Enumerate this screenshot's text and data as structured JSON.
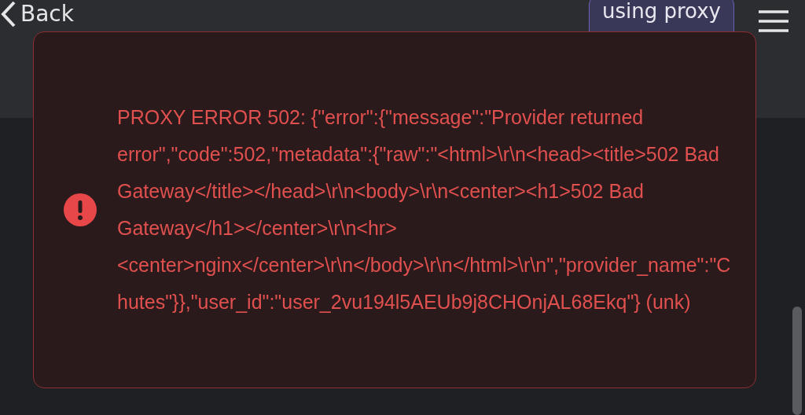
{
  "header": {
    "back_label": "Back",
    "proxy_button": "using proxy"
  },
  "error_toast": {
    "kind": "error",
    "message": "PROXY ERROR 502: {\"error\":{\"message\":\"Provider returned error\",\"code\":502,\"metadata\":{\"raw\":\"<html>\\r\\n<head><title>502 Bad Gateway</title></head>\\r\\n<body>\\r\\n<center><h1>502 Bad Gateway</h1></center>\\r\\n<hr><center>nginx</center>\\r\\n</body>\\r\\n</html>\\r\\n\",\"provider_name\":\"Chutes\"}},\"user_id\":\"user_2vu194l5AEUb9j8CHOnjAL68Ekq\"} (unk)"
  }
}
